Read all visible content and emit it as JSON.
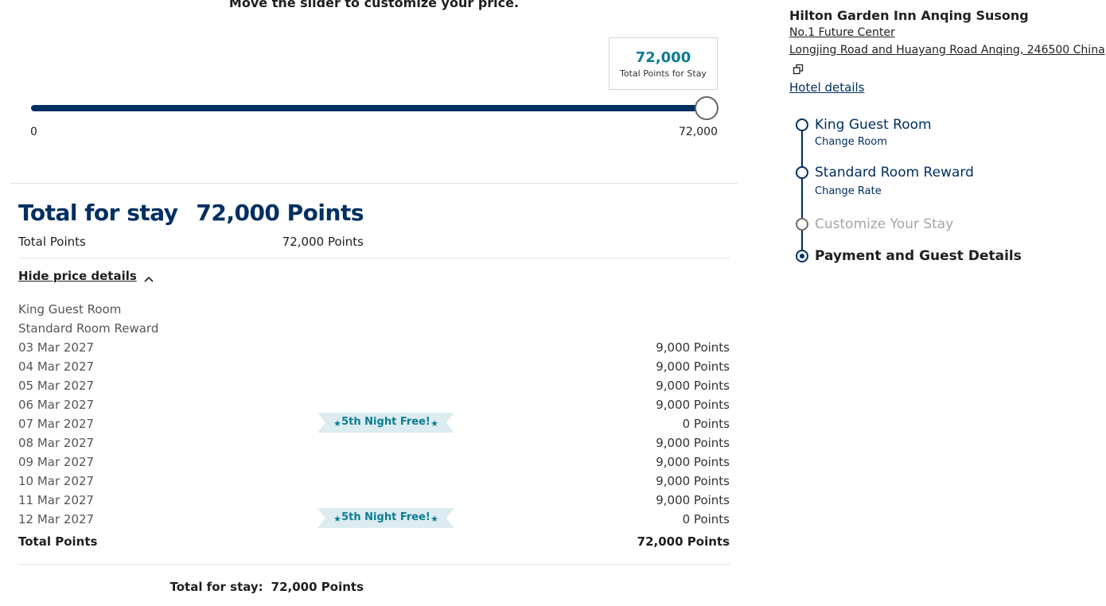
{
  "slider": {
    "heading": "Move the slider to customize your price.",
    "tooltip_value": "72,000",
    "tooltip_label": "Total Points for Stay",
    "min_label": "0",
    "max_label": "72,000",
    "value": 72000,
    "min": 0,
    "max": 72000
  },
  "summary": {
    "title": "Total for stay",
    "value": "72,000 Points",
    "total_points_label": "Total Points",
    "total_points_value": "72,000 Points"
  },
  "price_details": {
    "toggle_label": "Hide price details",
    "room": "King Guest Room",
    "rate": "Standard Room Reward",
    "nights": [
      {
        "date": "03 Mar 2027",
        "points": "9,000 Points",
        "badge": ""
      },
      {
        "date": "04 Mar 2027",
        "points": "9,000 Points",
        "badge": ""
      },
      {
        "date": "05 Mar 2027",
        "points": "9,000 Points",
        "badge": ""
      },
      {
        "date": "06 Mar 2027",
        "points": "9,000 Points",
        "badge": ""
      },
      {
        "date": "07 Mar 2027",
        "points": "0 Points",
        "badge": "5th Night Free!"
      },
      {
        "date": "08 Mar 2027",
        "points": "9,000 Points",
        "badge": ""
      },
      {
        "date": "09 Mar 2027",
        "points": "9,000 Points",
        "badge": ""
      },
      {
        "date": "10 Mar 2027",
        "points": "9,000 Points",
        "badge": ""
      },
      {
        "date": "11 Mar 2027",
        "points": "9,000 Points",
        "badge": ""
      },
      {
        "date": "12 Mar 2027",
        "points": "0 Points",
        "badge": "5th Night Free!"
      }
    ],
    "total_label": "Total Points",
    "total_value": "72,000 Points"
  },
  "footer": {
    "label": "Total for stay:",
    "value": "72,000 Points"
  },
  "hotel": {
    "name": "Hilton Garden Inn Anqing Susong",
    "address_line1": "No.1 Future Center",
    "address_line2": "Longjing Road and Huayang Road Anqing, 246500 China",
    "details_link": "Hotel details"
  },
  "steps": [
    {
      "title": "King Guest Room",
      "link": "Change Room",
      "state": "done"
    },
    {
      "title": "Standard Room Reward",
      "link": "Change Rate",
      "state": "done"
    },
    {
      "title": "Customize Your Stay",
      "link": "",
      "state": "skipped"
    },
    {
      "title": "Payment and Guest Details",
      "link": "",
      "state": "current"
    }
  ],
  "colors": {
    "navy": "#002f61",
    "teal": "#0c7c93",
    "ribbon_bg": "#dcecf1"
  },
  "icons": {
    "collapse": "chevron-up-icon",
    "external": "external-link-icon",
    "badge": "star-icon"
  }
}
